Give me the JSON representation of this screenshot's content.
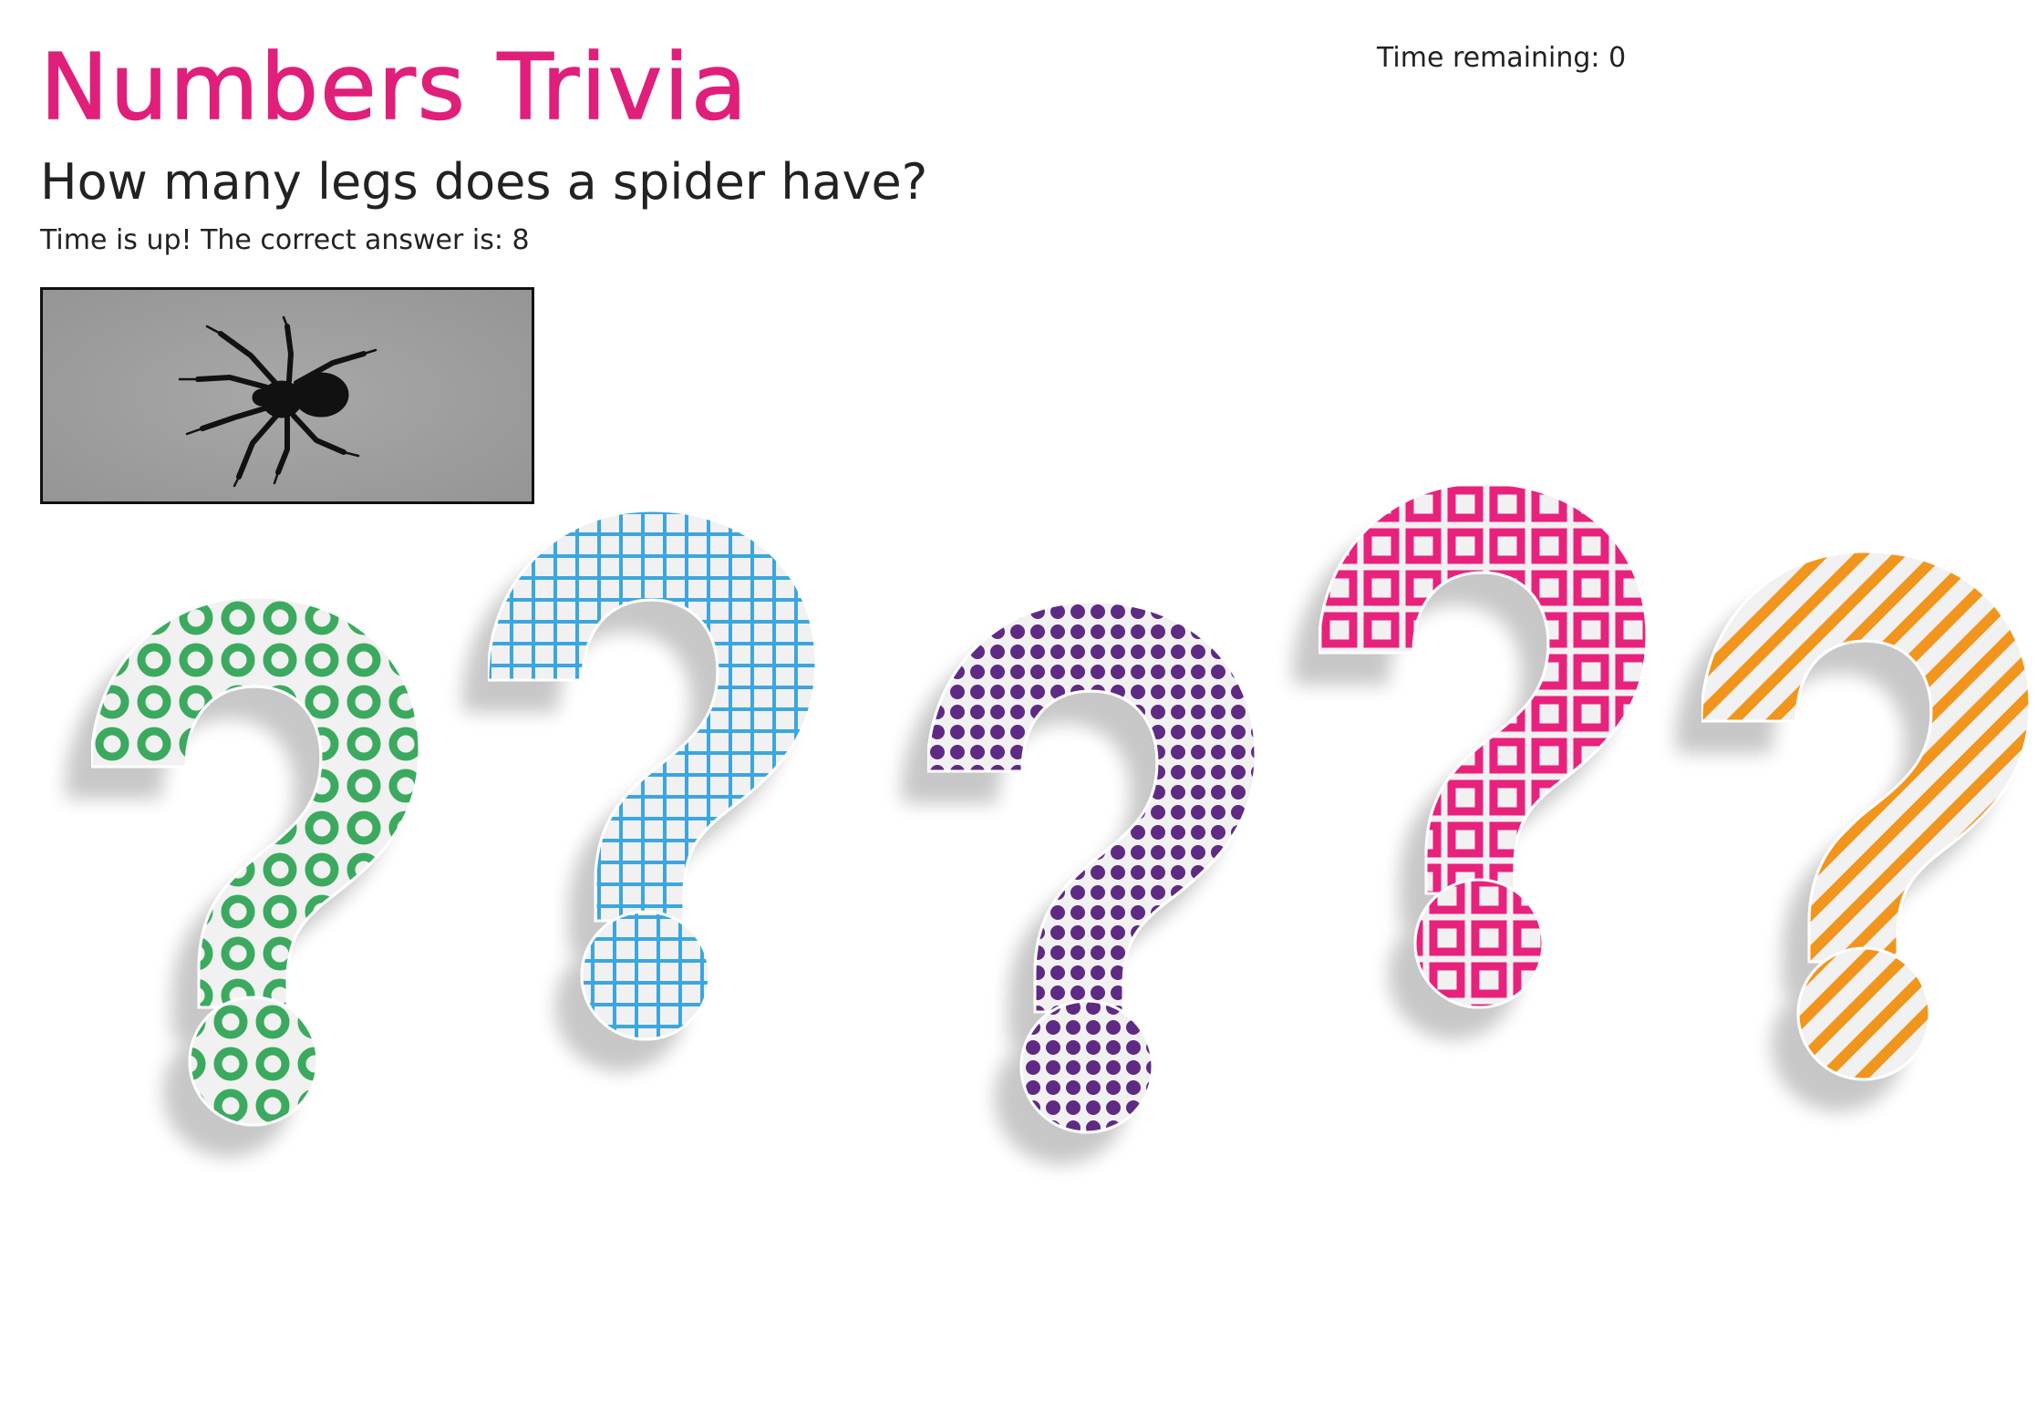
{
  "app": {
    "title": "Numbers Trivia",
    "title_color": "#e01f7b"
  },
  "timer": {
    "label": "Time remaining: 0",
    "seconds": 0
  },
  "question": {
    "text": "How many legs does a spider have?"
  },
  "result": {
    "text": "Time is up! The correct answer is: 8",
    "answer": 8
  },
  "image": {
    "subject": "spider-icon",
    "background": "#9d9d9d"
  },
  "decoration": {
    "question_marks": [
      {
        "name": "question-mark-green-rings",
        "pattern": "rings",
        "color": "#3aaa5e"
      },
      {
        "name": "question-mark-blue-grid",
        "pattern": "grid",
        "color": "#3aa6df"
      },
      {
        "name": "question-mark-purple-dots",
        "pattern": "dots",
        "color": "#5e2a84"
      },
      {
        "name": "question-mark-pink-squares",
        "pattern": "squares",
        "color": "#e8237c"
      },
      {
        "name": "question-mark-orange-stripes",
        "pattern": "stripes",
        "color": "#f2951f"
      }
    ]
  }
}
